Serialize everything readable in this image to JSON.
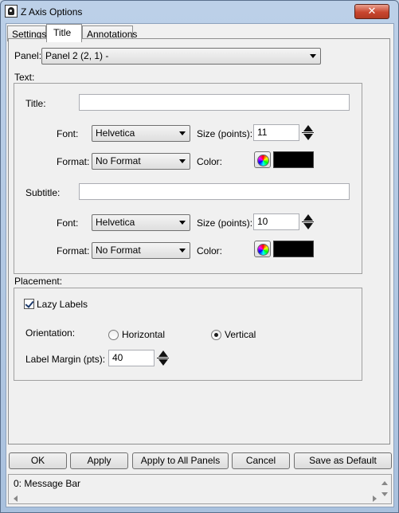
{
  "window": {
    "title": "Z Axis Options",
    "close_symbol": "✕"
  },
  "tabs": [
    {
      "label": "Settings"
    },
    {
      "label": "Title"
    },
    {
      "label": "Annotations"
    }
  ],
  "panel": {
    "label": "Panel:",
    "value": "Panel 2 (2, 1)  -"
  },
  "text_group": {
    "label": "Text:",
    "title": {
      "label": "Title:",
      "value": "",
      "font_label": "Font:",
      "font_value": "Helvetica",
      "size_label": "Size (points):",
      "size_value": "11",
      "format_label": "Format:",
      "format_value": "No Format",
      "color_label": "Color:",
      "color_value": "#000000"
    },
    "subtitle": {
      "label": "Subtitle:",
      "value": "",
      "font_label": "Font:",
      "font_value": "Helvetica",
      "size_label": "Size (points):",
      "size_value": "10",
      "format_label": "Format:",
      "format_value": "No Format",
      "color_label": "Color:",
      "color_value": "#000000"
    }
  },
  "placement": {
    "label": "Placement:",
    "lazy_labels": {
      "label": "Lazy Labels",
      "checked": true
    },
    "orientation_label": "Orientation:",
    "orientation_options": [
      {
        "label": "Horizontal",
        "checked": false
      },
      {
        "label": "Vertical",
        "checked": true
      }
    ],
    "label_margin": {
      "label": "Label Margin (pts):",
      "value": "40"
    }
  },
  "buttons": {
    "ok": "OK",
    "apply": "Apply",
    "apply_all": "Apply to All Panels",
    "cancel": "Cancel",
    "save_default": "Save as Default"
  },
  "message_bar": {
    "text": "0: Message Bar"
  }
}
